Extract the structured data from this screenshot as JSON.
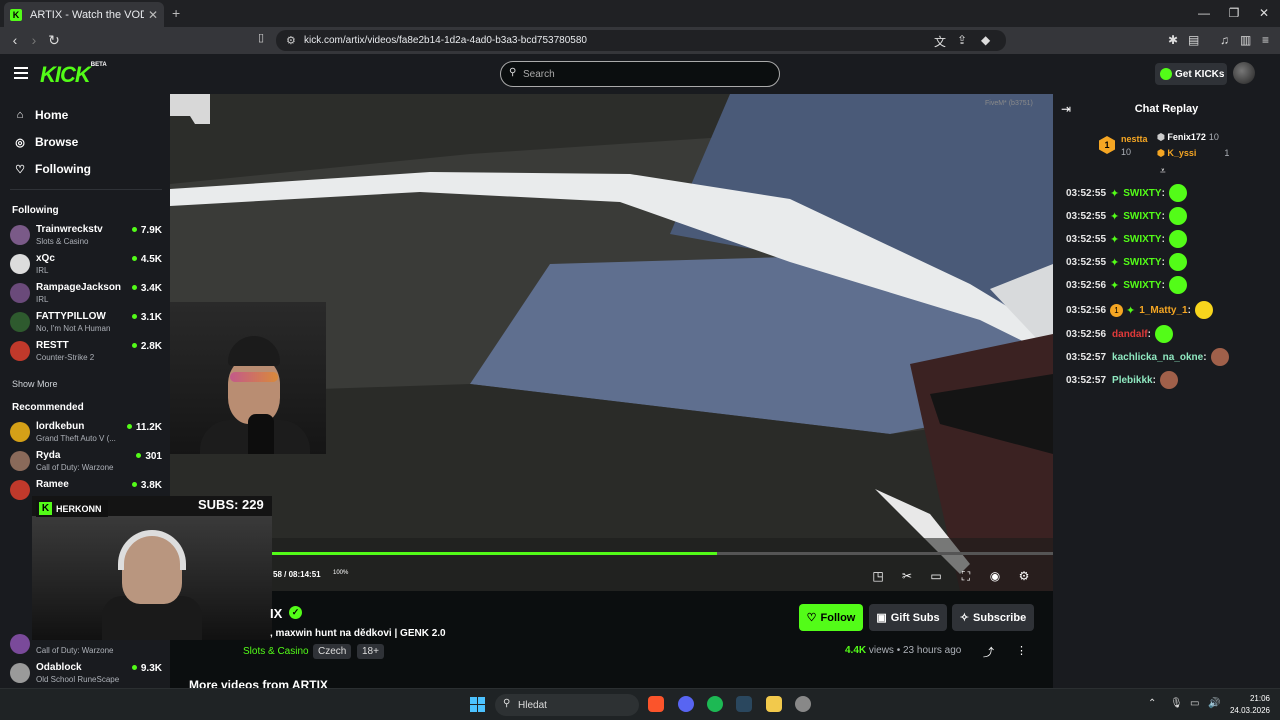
{
  "browser": {
    "tab_title": "ARTIX - Watch the VOD on Kick",
    "url": "kick.com/artix/videos/fa8e2b14-1d2a-4ad0-b3a3-bcd753780580"
  },
  "header": {
    "logo": "KICK",
    "logo_sup": "BETA",
    "search_placeholder": "Search",
    "get_kicks_label": "Get KICKs"
  },
  "sidebar": {
    "nav": [
      {
        "label": "Home",
        "icon": "home-icon"
      },
      {
        "label": "Browse",
        "icon": "compass-icon"
      },
      {
        "label": "Following",
        "icon": "heart-icon"
      }
    ],
    "following_title": "Following",
    "following": [
      {
        "name": "Trainwreckstv",
        "category": "Slots & Casino",
        "viewers": "7.9K",
        "color": "#7a5a88"
      },
      {
        "name": "xQc",
        "category": "IRL",
        "viewers": "4.5K",
        "color": "#dcdcdc"
      },
      {
        "name": "RampageJackson",
        "category": "IRL",
        "viewers": "3.4K",
        "color": "#6a4a7a"
      },
      {
        "name": "FATTYPILLOW",
        "category": "No, I'm Not A Human",
        "viewers": "3.1K",
        "color": "#2e5a2e"
      },
      {
        "name": "RESTT",
        "category": "Counter-Strike 2",
        "viewers": "2.8K",
        "color": "#c0392b"
      }
    ],
    "show_more": "Show More",
    "recommended_title": "Recommended",
    "recommended": [
      {
        "name": "lordkebun",
        "category": "Grand Theft Auto V (...",
        "viewers": "11.2K",
        "color": "#d4a017"
      },
      {
        "name": "Ryda",
        "category": "Call of Duty: Warzone",
        "viewers": "301",
        "color": "#8a6a5a"
      },
      {
        "name": "Ramee",
        "category": "",
        "viewers": "3.8K",
        "color": "#c0392b"
      },
      {
        "name": "",
        "category": "Call of Duty: Warzone",
        "viewers": "",
        "color": "#7a4a9a"
      },
      {
        "name": "Odablock",
        "category": "Old School RuneScape",
        "viewers": "9.3K",
        "color": "#9a9a9a"
      }
    ]
  },
  "overlay": {
    "badge": "HERKONN",
    "subs": "SUBS: 229"
  },
  "video": {
    "watermark": "FiveM* (b3751)",
    "timecode": "58 / 08:14:51",
    "volume": "100%",
    "progress": 0.57
  },
  "info": {
    "channel_name": "IX",
    "title": ", maxwin hunt na dědkovi | GENK 2.0",
    "category": "Slots & Casino",
    "tags": [
      "Czech",
      "18+"
    ],
    "follow_label": "Follow",
    "gift_label": "Gift Subs",
    "subscribe_label": "Subscribe",
    "views_count": "4.4K",
    "views_label": "views",
    "ago": "23 hours ago",
    "more_videos": "More videos from ARTIX"
  },
  "chat": {
    "title": "Chat Replay",
    "gifters": [
      {
        "name": "nestta",
        "count": "10"
      },
      {
        "name": "Fenix172",
        "count": "10"
      },
      {
        "name": "K_yssi",
        "count": "1"
      }
    ],
    "messages": [
      {
        "time": "03:52:55",
        "user": "SWIXTY",
        "color": "#53fc18",
        "emote": "#53fc18"
      },
      {
        "time": "03:52:55",
        "user": "SWIXTY",
        "color": "#53fc18",
        "emote": "#53fc18"
      },
      {
        "time": "03:52:55",
        "user": "SWIXTY",
        "color": "#53fc18",
        "emote": "#53fc18"
      },
      {
        "time": "03:52:55",
        "user": "SWIXTY",
        "color": "#53fc18",
        "emote": "#53fc18"
      },
      {
        "time": "03:52:56",
        "user": "SWIXTY",
        "color": "#53fc18",
        "emote": "#53fc18"
      },
      {
        "time": "03:52:56",
        "user": "1_Matty_1",
        "color": "#f5a623",
        "emote": "#f7d51d"
      },
      {
        "time": "03:52:56",
        "user": "dandalf",
        "color": "#e03a3a",
        "emote": "#53fc18"
      },
      {
        "time": "03:52:57",
        "user": "kachlicka_na_okne",
        "color": "#8fe8c0",
        "emote": "#a0604a"
      },
      {
        "time": "03:52:57",
        "user": "Plebikkk",
        "color": "#8fe8c0",
        "emote": "#a0604a"
      }
    ]
  },
  "taskbar": {
    "search_label": "Hledat",
    "time": "21:06",
    "date": "24.03.2026"
  }
}
